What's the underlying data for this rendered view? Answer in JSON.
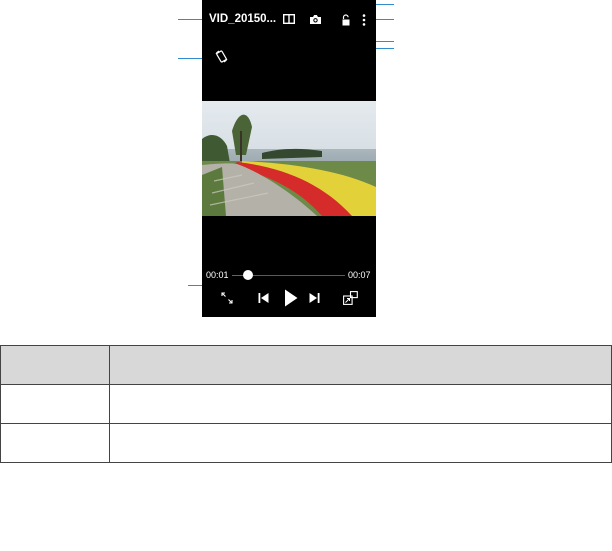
{
  "player": {
    "file_name": "VID_20150...",
    "elapsed": "00:01",
    "duration": "00:07",
    "progress": 0.14
  },
  "icons": {
    "rotate": "auto-rotate-icon",
    "split": "split-screen-icon",
    "camera": "screenshot-camera-icon",
    "lock": "lock-icon",
    "more": "more-options-icon",
    "fullscreen": "fullscreen-icon",
    "previous": "previous-icon",
    "play": "play-icon",
    "next": "next-icon",
    "popup": "popup-window-icon"
  },
  "colors": {
    "callout": "#2e8ccf",
    "seek_played": "#e91e63",
    "table_header": "#d8d8d8"
  },
  "table": {
    "header": [
      "",
      ""
    ],
    "rows": [
      [
        "",
        ""
      ],
      [
        "",
        ""
      ]
    ]
  }
}
